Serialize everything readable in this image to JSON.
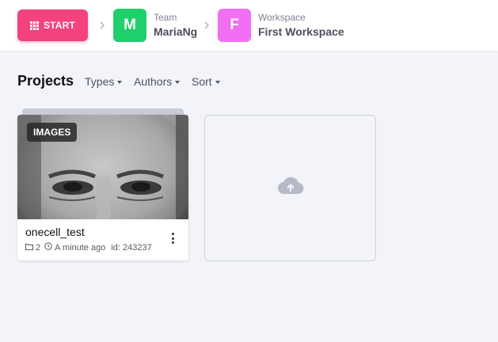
{
  "header": {
    "start_label": "START",
    "team": {
      "initial": "M",
      "label": "Team",
      "name": "MariaNg",
      "color": "#1fcf6c"
    },
    "workspace": {
      "initial": "F",
      "label": "Workspace",
      "name": "First Workspace",
      "color": "#f06ff3"
    },
    "start_color": "#f3427c"
  },
  "projects": {
    "title": "Projects",
    "filters": [
      {
        "label": "Types"
      },
      {
        "label": "Authors"
      },
      {
        "label": "Sort"
      }
    ],
    "items": [
      {
        "badge": "IMAGES",
        "name": "onecell_test",
        "datasets": "2",
        "updated": "A minute ago",
        "id_text": "id: 243237"
      }
    ]
  },
  "icons": {
    "start": "grid-icon",
    "breadcrumb_separator": "chevron-right-icon",
    "folder": "folder-icon",
    "clock": "clock-icon",
    "menu": "more-vertical-icon",
    "upload": "cloud-upload-icon"
  }
}
